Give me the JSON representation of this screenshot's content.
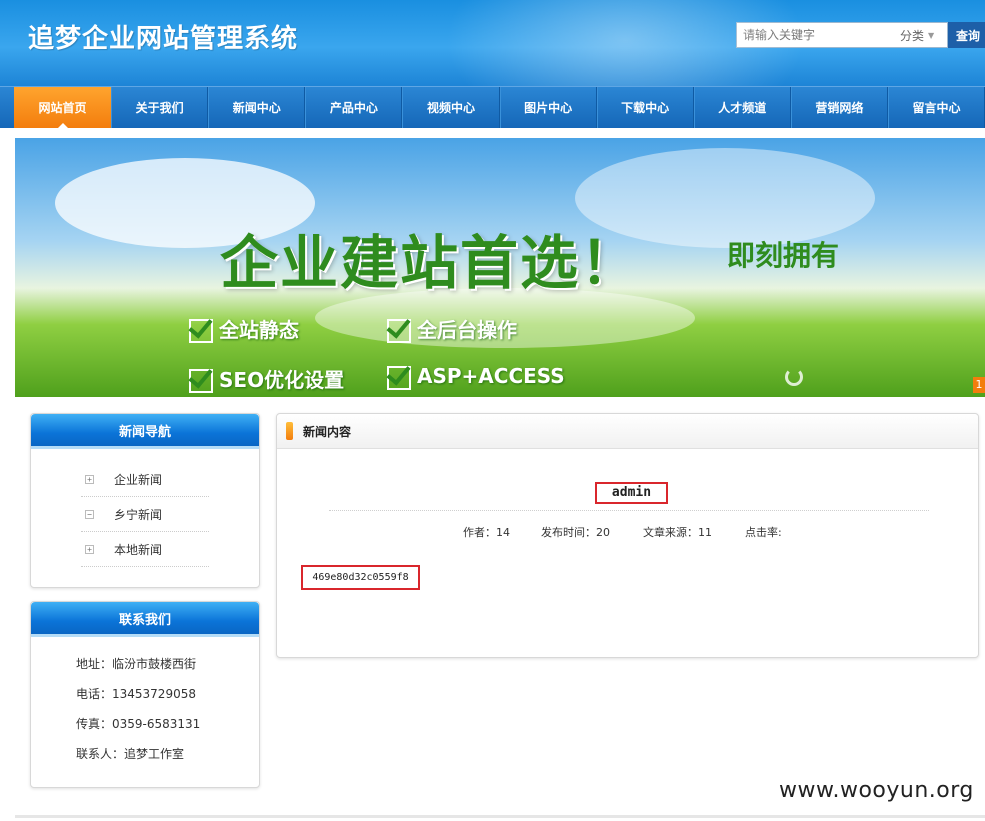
{
  "header": {
    "site_title": "追梦企业网站管理系统",
    "search_placeholder": "请输入关键字",
    "search_category": "分类",
    "search_button": "查询"
  },
  "nav": [
    {
      "label": "网站首页",
      "active": true
    },
    {
      "label": "关于我们"
    },
    {
      "label": "新闻中心"
    },
    {
      "label": "产品中心"
    },
    {
      "label": "视频中心"
    },
    {
      "label": "图片中心"
    },
    {
      "label": "下载中心"
    },
    {
      "label": "人才频道"
    },
    {
      "label": "营销网络"
    },
    {
      "label": "留言中心"
    }
  ],
  "banner": {
    "headline": "企业建站首选！",
    "sub": "即刻拥有",
    "features": [
      "全站静态",
      "全后台操作",
      "SEO优化设置",
      "ASP+ACCESS"
    ],
    "page_indicator": "1"
  },
  "sidebar": {
    "news_nav": {
      "title": "新闻导航",
      "items": [
        {
          "label": "企业新闻",
          "toggle": "+"
        },
        {
          "label": "乡宁新闻",
          "toggle": "−"
        },
        {
          "label": "本地新闻",
          "toggle": "+"
        }
      ]
    },
    "contact": {
      "title": "联系我们",
      "address": "地址：临汾市鼓楼西街",
      "phone": "电话：13453729058",
      "fax": "传真：0359-6583131",
      "person": "联系人：追梦工作室"
    }
  },
  "content": {
    "header": "新闻内容",
    "article_title": "admin",
    "author": "作者：14",
    "publish_time": "发布时间：20",
    "source": "文章来源：11",
    "clicks": "点击率:",
    "body": "469e80d32c0559f8"
  },
  "watermark": "www.wooyun.org"
}
